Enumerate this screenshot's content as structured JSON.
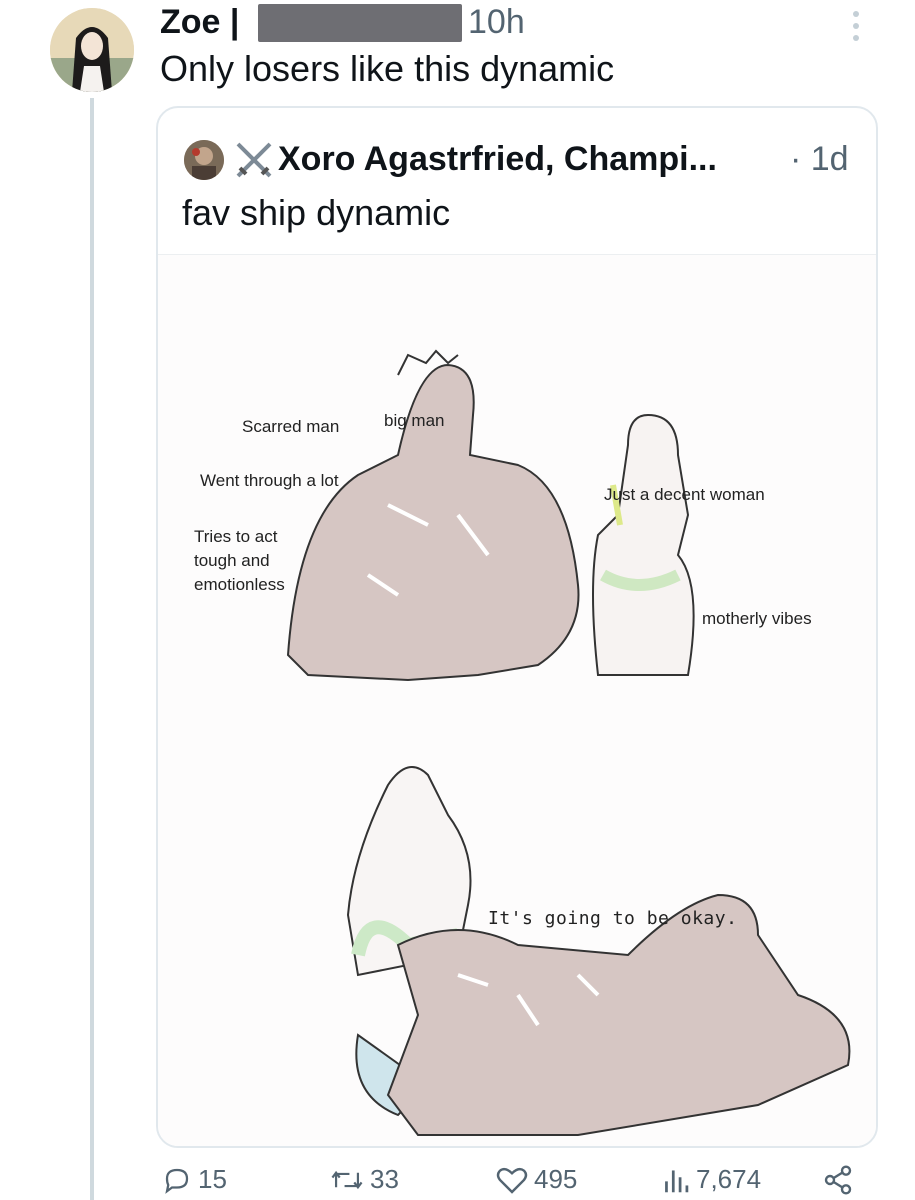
{
  "tweet": {
    "author_name": "Zoe |",
    "timestamp": "10h",
    "text": "Only losers like this dynamic"
  },
  "quote": {
    "author_name": "Xoro Agastrfried, Champi...",
    "timestamp": "· 1d",
    "text": "fav ship dynamic",
    "media": {
      "labels": {
        "scarred_man": "Scarred man",
        "big_man": "big man",
        "went_through": "Went through a lot",
        "tries_to_act": "Tries to act\ntough and\nemotionless",
        "decent_woman": "Just a decent woman",
        "motherly_vibes": "motherly vibes",
        "its_okay": "It's going to be okay."
      }
    }
  },
  "actions": {
    "replies": "15",
    "retweets": "33",
    "likes": "495",
    "views": "7,674"
  },
  "colors": {
    "text": "#0f1419",
    "secondary": "#536471",
    "border": "#e1e8ed",
    "skin_shade": "#cbb9b6"
  },
  "icons": [
    "more-icon",
    "crossed-swords-icon",
    "reply-icon",
    "retweet-icon",
    "like-icon",
    "views-icon",
    "share-icon"
  ]
}
